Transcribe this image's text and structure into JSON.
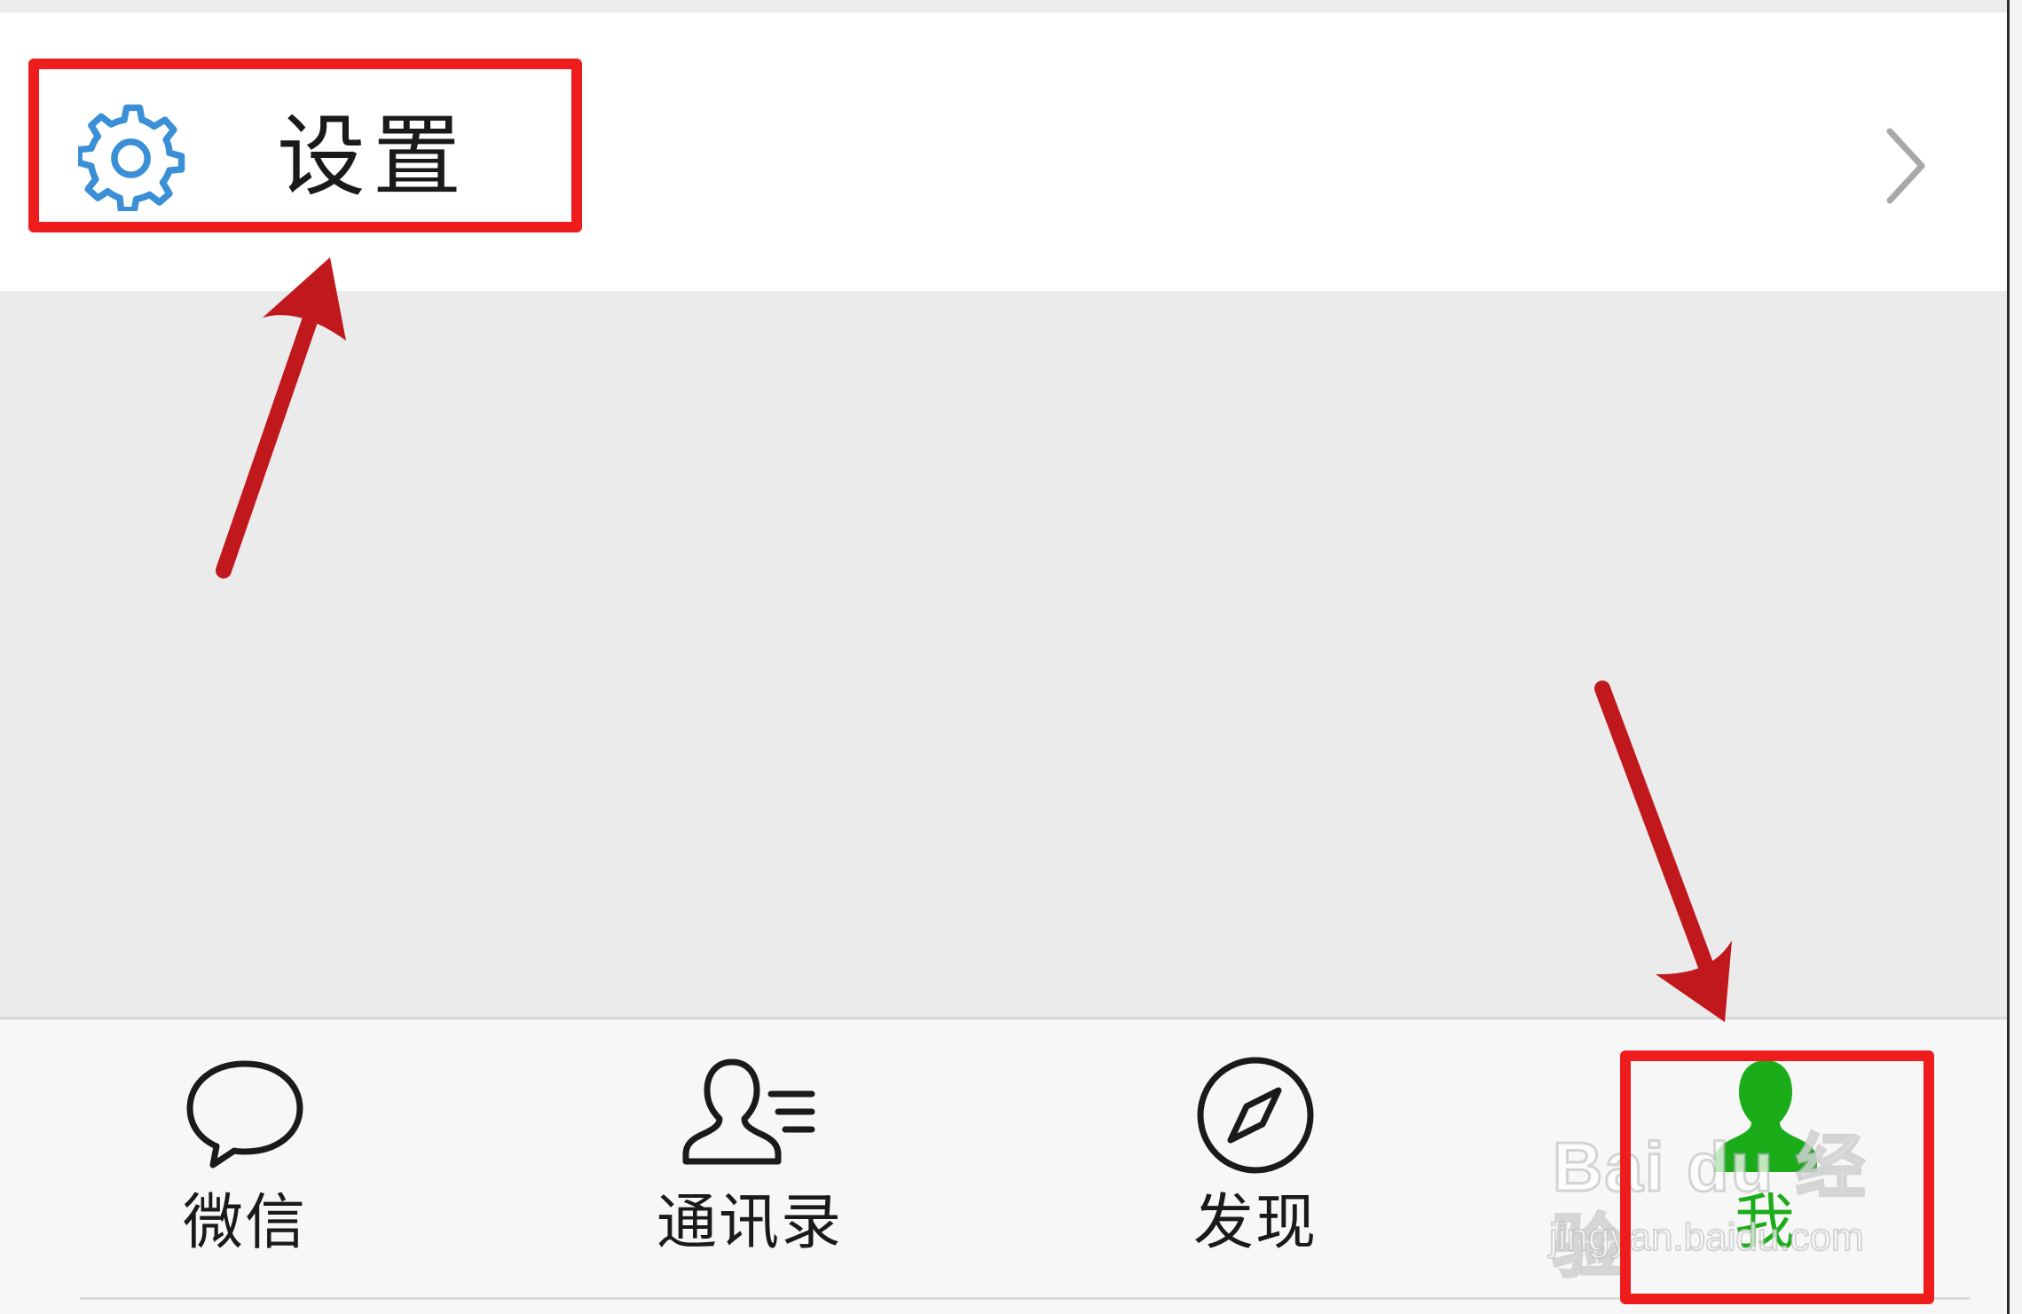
{
  "settings": {
    "label": "设置",
    "icon": "gear-icon",
    "icon_color": "#3a8fd6",
    "chevron": "chevron-right-icon"
  },
  "tabbar": {
    "tabs": [
      {
        "label": "微信",
        "icon": "chat-bubble-icon",
        "active": false
      },
      {
        "label": "通讯录",
        "icon": "contacts-icon",
        "active": false
      },
      {
        "label": "发现",
        "icon": "compass-icon",
        "active": false
      },
      {
        "label": "我",
        "icon": "person-icon",
        "active": true
      }
    ],
    "active_color": "#1aad19"
  },
  "annotations": {
    "highlight_color": "#ee1c1c",
    "arrow_color": "#c0181d"
  },
  "watermark": {
    "main": "Bai du 经验",
    "sub": "jingyan.baidu.com"
  }
}
